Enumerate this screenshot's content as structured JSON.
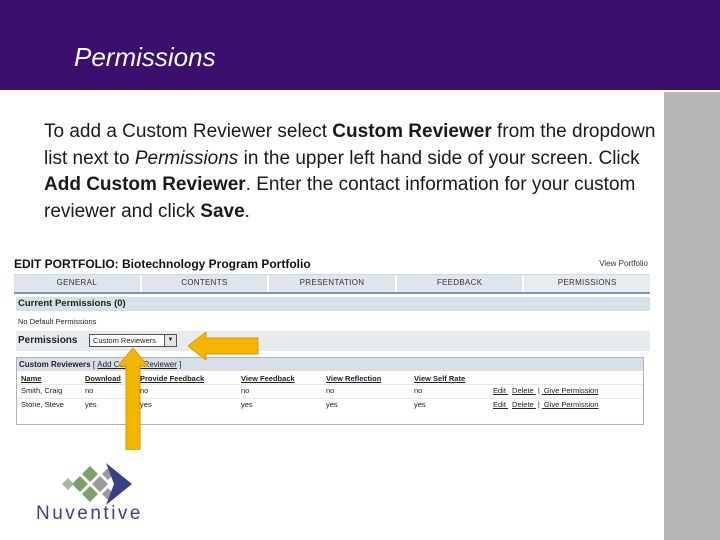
{
  "header": {
    "title": "Permissions"
  },
  "instructions": {
    "p1": "To add a Custom Reviewer select ",
    "b1": "Custom Reviewer",
    "p2": " from the dropdown list next to ",
    "i1": "Permissions",
    "p3": " in the upper left hand side of your screen.  Click ",
    "b2": "Add Custom Reviewer",
    "p4": ".  Enter the contact information for your custom reviewer and click ",
    "b3": "Save",
    "p5": "."
  },
  "screenshot": {
    "title": "EDIT PORTFOLIO: Biotechnology Program Portfolio",
    "view_link": "View Portfolio",
    "tabs": [
      "GENERAL",
      "CONTENTS",
      "PRESENTATION",
      "FEEDBACK",
      "PERMISSIONS"
    ],
    "current_permissions": "Current Permissions (0)",
    "no_default": "No Default Permissions",
    "permissions_label": "Permissions",
    "select_value": "Custom Reviewers",
    "custom_reviewers": {
      "label": "Custom Reviewers",
      "separator": "[",
      "add_link": "Add Custom Reviewer",
      "close": "]",
      "columns": [
        "Name",
        "Download",
        "Provide Feedback",
        "View Feedback",
        "View Reflection",
        "View Self Rate"
      ],
      "rows": [
        {
          "name": "Smith, Craig",
          "download": "no",
          "provide": "no",
          "view_feedback": "no",
          "reflection": "no",
          "self_rate": "no"
        },
        {
          "name": "Stone, Steve",
          "download": "yes",
          "provide": "yes",
          "view_feedback": "yes",
          "reflection": "yes",
          "self_rate": "yes"
        }
      ],
      "actions": {
        "edit": "Edit",
        "delete": "Delete",
        "give": "Give Permission",
        "pipe": "|"
      }
    }
  },
  "logo": {
    "text": "Nuventive"
  },
  "colors": {
    "header": "#3b0f6e",
    "arrow": "#f5b400",
    "sidebar": "#b7b7b7"
  }
}
